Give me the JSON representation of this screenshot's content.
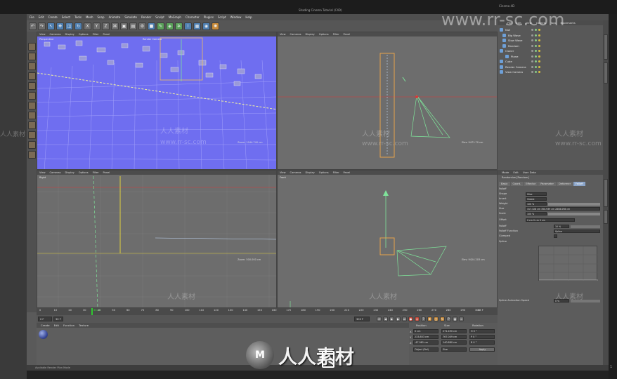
{
  "screen": {
    "top_left": "Shading Cinema Tutorial (C4D)",
    "top_right": "Cinema 4D",
    "bottom_right": "1"
  },
  "menubar": [
    "File",
    "Edit",
    "Create",
    "Select",
    "Tools",
    "Mesh",
    "Snap",
    "Animate",
    "Simulate",
    "Render",
    "Sculpt",
    "MoGraph",
    "Character",
    "Plugins",
    "Script",
    "Window",
    "Help"
  ],
  "viewport_menu": [
    "View",
    "Cameras",
    "Display",
    "Options",
    "Filter",
    "Panel"
  ],
  "viewports": [
    {
      "label": "Perspective",
      "camera": "Render Camera",
      "distance": "Zoom: 1044.740 cm"
    },
    {
      "label": "",
      "camera": "",
      "distance": "Elev: 9471.70 cm"
    },
    {
      "label": "Right",
      "camera": "",
      "distance": "Zoom: 500.000 cm"
    },
    {
      "label": "Front",
      "camera": "",
      "distance": "Elev: 9424.203 cm"
    }
  ],
  "timeline": {
    "ticks": [
      "0",
      "10",
      "20",
      "30",
      "40",
      "50",
      "60",
      "70",
      "80",
      "90",
      "100",
      "110",
      "120",
      "130",
      "140",
      "150",
      "160",
      "170",
      "180",
      "190",
      "200",
      "210",
      "220",
      "230",
      "240",
      "250",
      "260",
      "270",
      "280",
      "290",
      "300"
    ],
    "current_frame": "33 F",
    "current_marker": "33.40",
    "end_frame": "300 F",
    "start_field": "0 F",
    "fps": "30 F"
  },
  "material_menu": [
    "Create",
    "Edit",
    "Function",
    "Texture"
  ],
  "coordinates": {
    "headers": [
      "Position",
      "Size",
      "Rotation"
    ],
    "rows": [
      {
        "axis": "X",
        "pos": "0 cm",
        "size": "271.490 cm",
        "rot": "H  0 °"
      },
      {
        "axis": "Y",
        "pos": "233.853 cm",
        "size": "767.009 cm",
        "rot": "P  0 °"
      },
      {
        "axis": "Z",
        "pos": "-47.981 cm",
        "size": "140.880 cm",
        "rot": "B  0 °"
      }
    ],
    "mode": "Object (Rel)",
    "size_mode": "Size",
    "apply": "Apply"
  },
  "object_manager": {
    "menu": [
      "File",
      "Edit",
      "View",
      "Objects",
      "Tags",
      "Bookmarks"
    ],
    "items": [
      {
        "name": "Null",
        "indent": 0
      },
      {
        "name": "Big Wave",
        "indent": 1
      },
      {
        "name": "Slow Wave",
        "indent": 1
      },
      {
        "name": "Random",
        "indent": 1
      },
      {
        "name": "Cloner",
        "indent": 0
      },
      {
        "name": "Plane",
        "indent": 2
      },
      {
        "name": "Cube",
        "indent": 0
      },
      {
        "name": "Render Camera",
        "indent": 0
      },
      {
        "name": "View Camera",
        "indent": 0
      }
    ]
  },
  "attributes": {
    "menu": [
      "Mode",
      "Edit",
      "User Data"
    ],
    "title": "Randomize [Random]",
    "tabs": [
      "Basic",
      "Coord.",
      "Effector",
      "Parameter",
      "Deformer",
      "Falloff"
    ],
    "section": "Falloff",
    "rows": [
      {
        "label": "Shape",
        "value": "Slice"
      },
      {
        "label": "Invert",
        "value": "Visible"
      },
      {
        "label": "Weight",
        "value": "100 %"
      },
      {
        "label": "Size",
        "value": "317.328 cm   350.939 cm   2808.098 cm"
      },
      {
        "label": "Scale",
        "value": "100 %"
      },
      {
        "label": "Offset",
        "value": "0 cm   0 cm   0 cm"
      },
      {
        "label": "Falloff",
        "value": "10 %"
      },
      {
        "label": "Falloff Function",
        "value": "Spline"
      },
      {
        "label": "Clamped",
        "value": ""
      },
      {
        "label": "Spline",
        "value": ""
      }
    ],
    "spline_speed_label": "Spline Animation Speed",
    "spline_speed_value": "0 %"
  },
  "status": "Available Render Plan Mode",
  "watermarks": {
    "site": "www.rr-sc.com",
    "cn": "人人素材",
    "big": "人人素材"
  },
  "colors": {
    "viewport_blue": "#6f6ef0",
    "grid_gray": "#7a7a7a",
    "camera_green": "#7fe39a",
    "select_orange": "#e8a34a",
    "axis_red": "#d83838",
    "timeline_green": "#30c830"
  }
}
